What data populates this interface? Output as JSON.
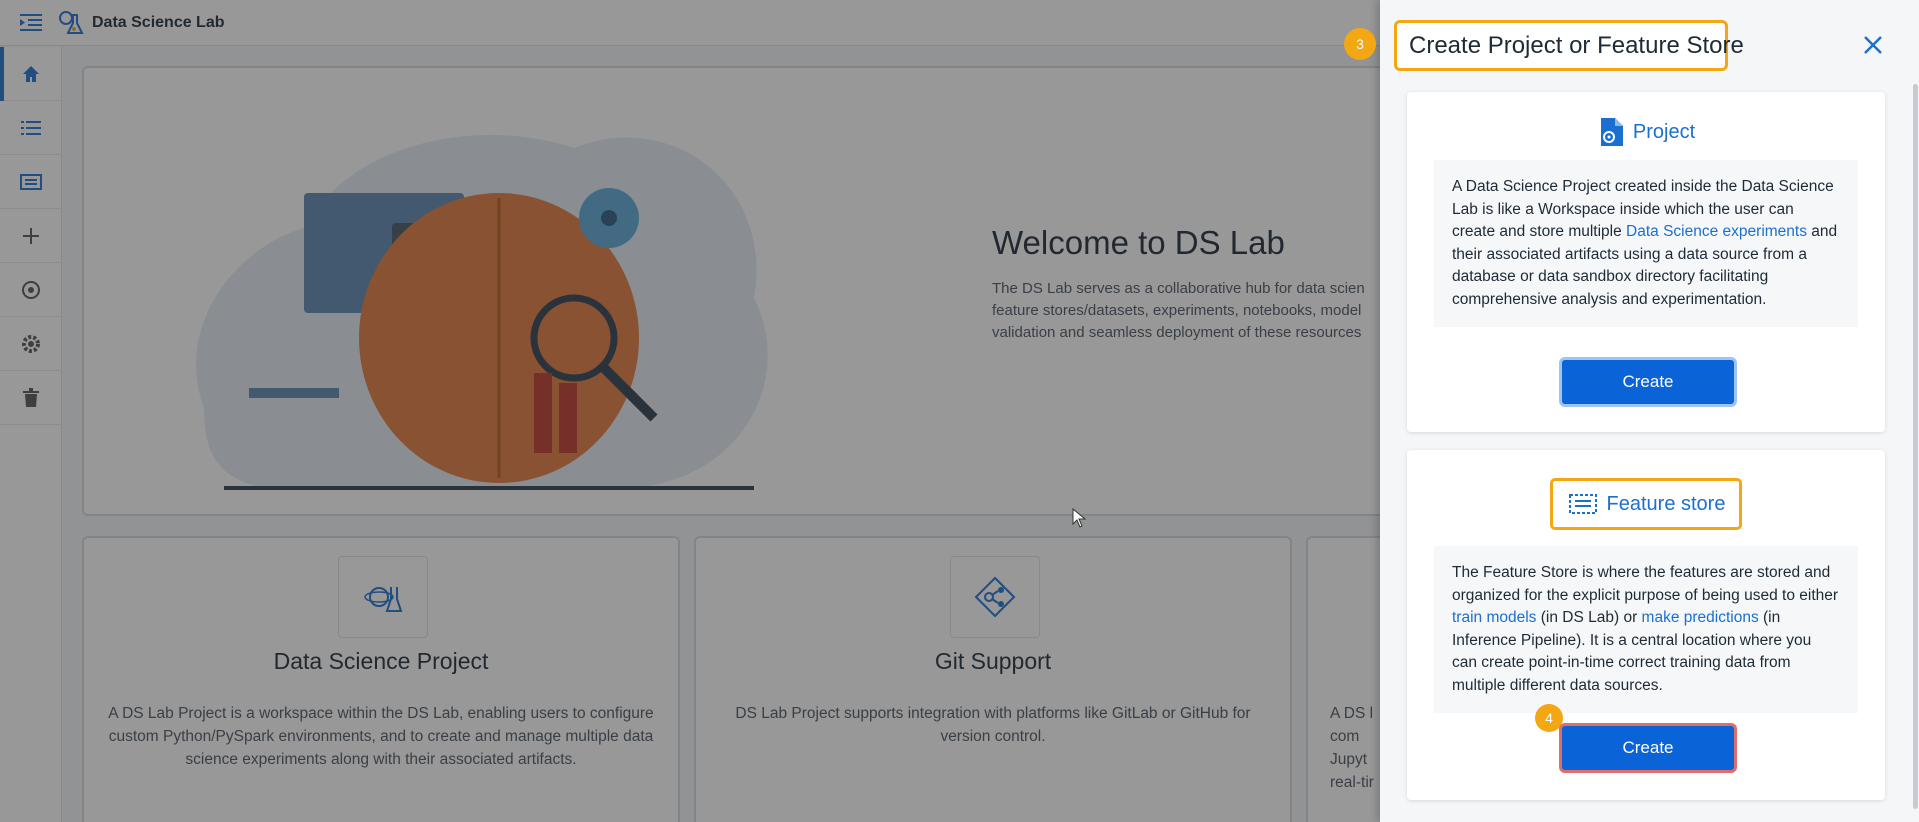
{
  "app": {
    "title": "Data Science Lab"
  },
  "sidebar": {
    "items": [
      {
        "icon": "home-icon"
      },
      {
        "icon": "list-icon"
      },
      {
        "icon": "feature-store-icon"
      },
      {
        "icon": "add-icon"
      },
      {
        "icon": "models-icon"
      },
      {
        "icon": "settings-icon"
      },
      {
        "icon": "trash-icon"
      }
    ]
  },
  "welcome": {
    "title": "Welcome to DS Lab",
    "text": "The DS Lab serves as a collaborative hub for data scien feature stores/datasets, experiments, notebooks, model validation and seamless deployment of these resources"
  },
  "cards": [
    {
      "title": "Data Science Project",
      "text": "A DS Lab Project is a workspace within the DS Lab, enabling users to configure custom Python/PySpark environments, and to create and manage multiple data science experiments along with their associated artifacts."
    },
    {
      "title": "Git Support",
      "text": "DS Lab Project supports integration with platforms like GitLab or GitHub for version control."
    },
    {
      "title": "",
      "text": "A DS l com Jupyt real-tir"
    }
  ],
  "drawer": {
    "title": "Create Project or Feature Store",
    "title_step": "3",
    "project": {
      "label": "Project",
      "desc_1": "A Data Science Project created inside the Data Science Lab is like a Workspace inside which the user can create and store multiple ",
      "desc_link": "Data Science experiments",
      "desc_2": " and their associated artifacts using a data source from a database or data sandbox directory facilitating comprehensive analysis and experimentation.",
      "button": "Create"
    },
    "feature_store": {
      "label": "Feature store",
      "desc_1": "The Feature Store is where the features are stored and organized for the explicit purpose of being used to either ",
      "desc_link_1": "train models",
      "desc_2": " (in DS Lab) or ",
      "desc_link_2": "make predictions",
      "desc_3": " (in Inference Pipeline). It is a central location where you can create point-in-time correct training data from multiple different data sources.",
      "button": "Create",
      "button_step": "4"
    }
  },
  "colors": {
    "accent": "#1b6fd1",
    "highlight": "#f3a712",
    "button": "#0b63d8"
  }
}
